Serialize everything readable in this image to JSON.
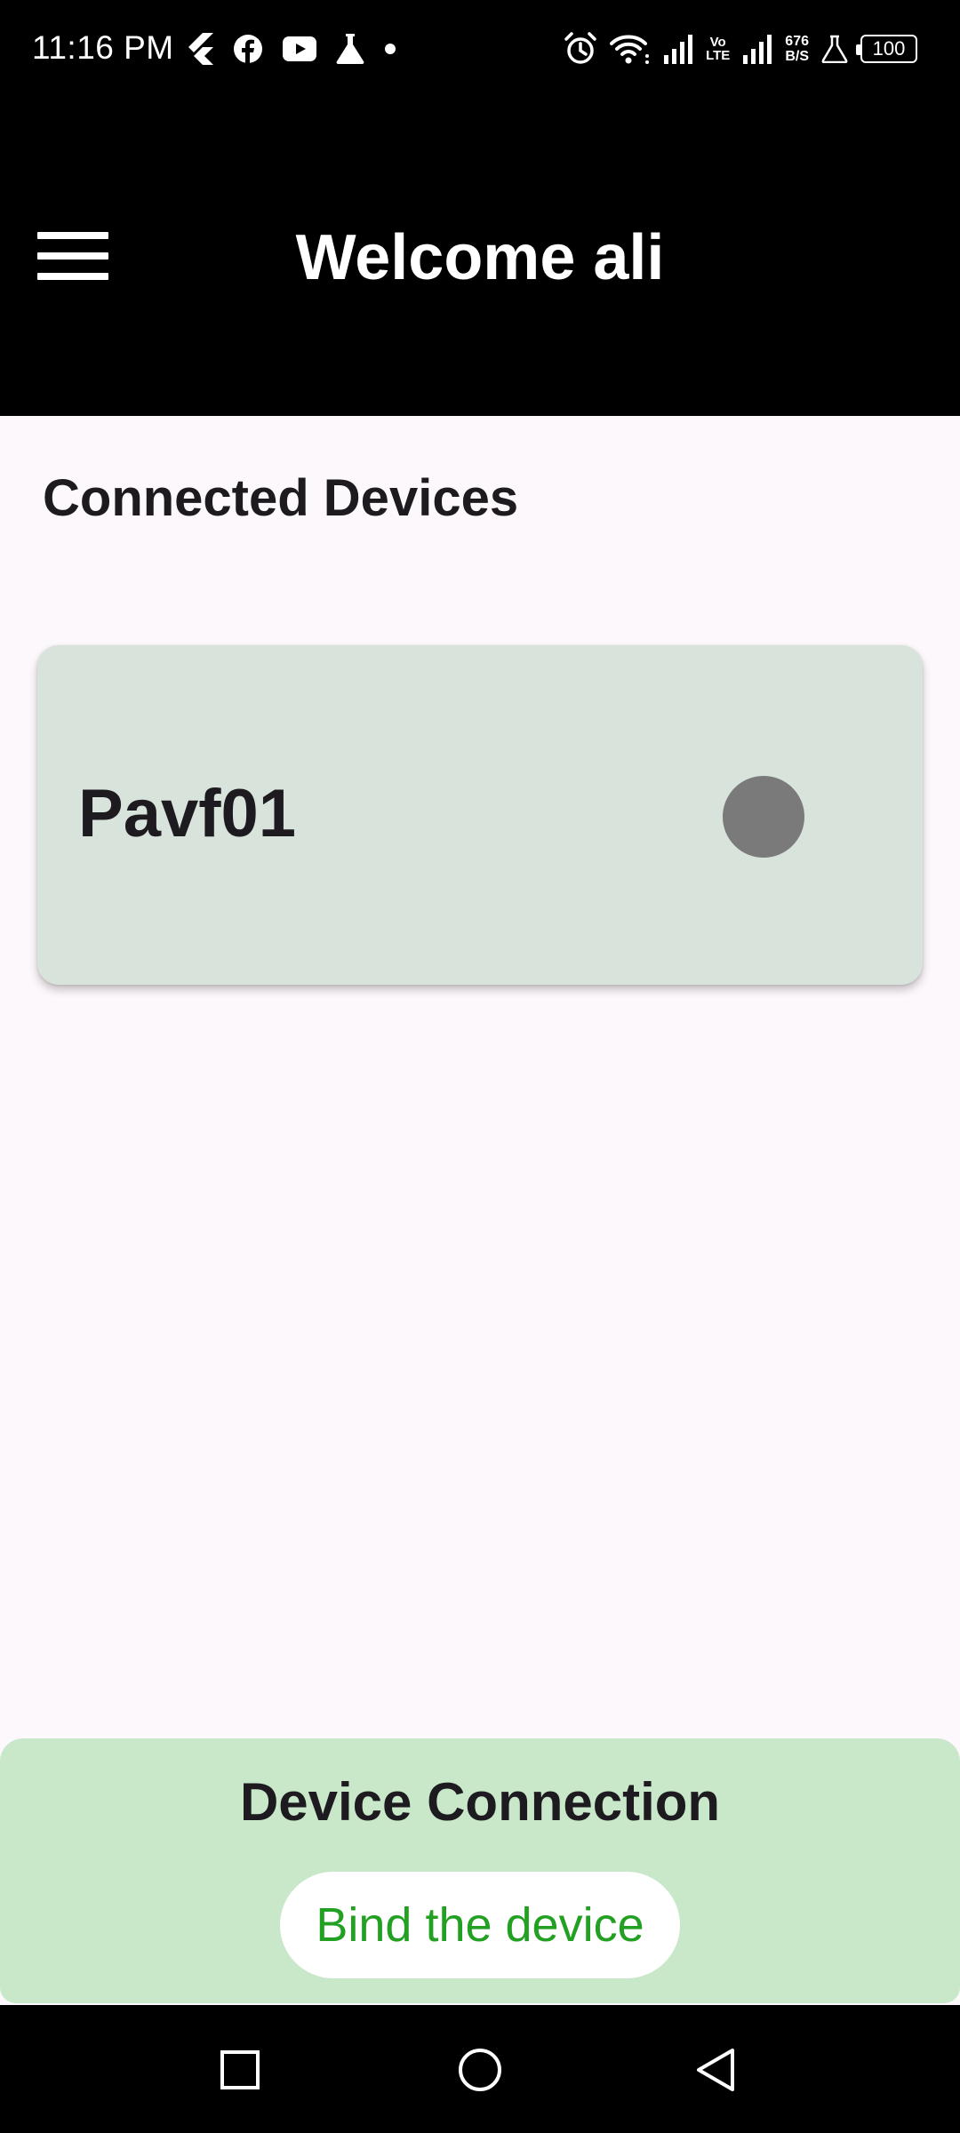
{
  "status_bar": {
    "time": "11:16 PM",
    "left_icons": [
      "flutter-icon",
      "facebook-icon",
      "youtube-icon",
      "flask-icon",
      "dot-icon"
    ],
    "right_icons": [
      "alarm-icon",
      "wifi-icon",
      "signal-icon",
      "signal-icon",
      "flask-icon"
    ],
    "vo_lte": {
      "top": "Vo",
      "bottom": "LTE"
    },
    "net_speed": {
      "value": "676",
      "unit": "B/S"
    },
    "battery": "100"
  },
  "app_bar": {
    "title": "Welcome ali",
    "background": "#000000"
  },
  "main": {
    "section_title": "Connected Devices",
    "devices": [
      {
        "name": "Pavf01",
        "status_color": "#7a7a7a"
      }
    ]
  },
  "bottom_panel": {
    "title": "Device Connection",
    "bind_button_label": "Bind the device",
    "background": "#c8e8c9",
    "accent": "#22a022"
  },
  "nav_bar": {
    "buttons": [
      "recents-icon",
      "home-icon",
      "back-icon"
    ]
  }
}
